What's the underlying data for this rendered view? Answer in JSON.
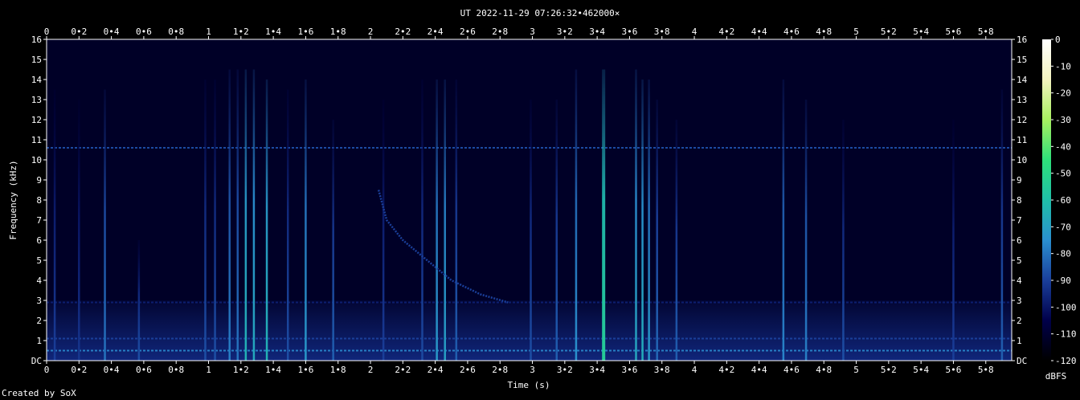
{
  "chart_data": {
    "type": "heatmap",
    "title": "UT 2022-11-29 07:26:32•462000×",
    "xlabel": "Time (s)",
    "ylabel": "Frequency (kHz)",
    "colorbar_label": "dBFS",
    "xlim": [
      0,
      5.96
    ],
    "ylim": [
      0,
      16
    ],
    "x_ticks": [
      "0",
      "0•2",
      "0•4",
      "0•6",
      "0•8",
      "1",
      "1•2",
      "1•4",
      "1•6",
      "1•8",
      "2",
      "2•2",
      "2•4",
      "2•6",
      "2•8",
      "3",
      "3•2",
      "3•4",
      "3•6",
      "3•8",
      "4",
      "4•2",
      "4•4",
      "4•6",
      "4•8",
      "5",
      "5•2",
      "5•4",
      "5•6",
      "5•8"
    ],
    "x_tick_values": [
      0,
      0.2,
      0.4,
      0.6,
      0.8,
      1,
      1.2,
      1.4,
      1.6,
      1.8,
      2,
      2.2,
      2.4,
      2.6,
      2.8,
      3,
      3.2,
      3.4,
      3.6,
      3.8,
      4,
      4.2,
      4.4,
      4.6,
      4.8,
      5,
      5.2,
      5.4,
      5.6,
      5.8
    ],
    "y_ticks": [
      "DC",
      "1",
      "2",
      "3",
      "4",
      "5",
      "6",
      "7",
      "8",
      "9",
      "10",
      "11",
      "12",
      "13",
      "14",
      "15",
      "16"
    ],
    "y_tick_values": [
      0,
      1,
      2,
      3,
      4,
      5,
      6,
      7,
      8,
      9,
      10,
      11,
      12,
      13,
      14,
      15,
      16
    ],
    "colorbar_ticks": [
      "0",
      "-10",
      "-20",
      "-30",
      "-40",
      "-50",
      "-60",
      "-70",
      "-80",
      "-90",
      "-100",
      "-110",
      "-120"
    ],
    "colorbar_values": [
      0,
      -10,
      -20,
      -30,
      -40,
      -50,
      -60,
      -70,
      -80,
      -90,
      -100,
      -110,
      -120
    ],
    "colorbar_range": [
      -120,
      0
    ],
    "colormap": [
      "#000000",
      "#00004a",
      "#1a3f9a",
      "#2a8fd0",
      "#1fbfa8",
      "#2ee07a",
      "#a8f060",
      "#f4f4c0",
      "#ffffff"
    ],
    "background_level_dbfs": -112,
    "low_freq_band": {
      "freq_range_khz": [
        0,
        3
      ],
      "level_dbfs": -96
    },
    "horizontal_lines": [
      {
        "freq_khz": 10.6,
        "level_dbfs": -88
      },
      {
        "freq_khz": 0.5,
        "level_dbfs": -78
      },
      {
        "freq_khz": 1.1,
        "level_dbfs": -90
      },
      {
        "freq_khz": 2.9,
        "level_dbfs": -98
      }
    ],
    "events": [
      {
        "t": 0.05,
        "f_top": 13.5,
        "level_dbfs": -98
      },
      {
        "t": 0.2,
        "f_top": 13.0,
        "level_dbfs": -100
      },
      {
        "t": 0.36,
        "f_top": 13.5,
        "level_dbfs": -88
      },
      {
        "t": 0.57,
        "f_top": 6.0,
        "level_dbfs": -95
      },
      {
        "t": 0.98,
        "f_top": 14.0,
        "level_dbfs": -95
      },
      {
        "t": 1.04,
        "f_top": 14.0,
        "level_dbfs": -95
      },
      {
        "t": 1.13,
        "f_top": 14.5,
        "level_dbfs": -86
      },
      {
        "t": 1.18,
        "f_top": 14.5,
        "level_dbfs": -88
      },
      {
        "t": 1.23,
        "f_top": 14.5,
        "level_dbfs": -72
      },
      {
        "t": 1.28,
        "f_top": 14.5,
        "level_dbfs": -75
      },
      {
        "t": 1.36,
        "f_top": 14.0,
        "level_dbfs": -72
      },
      {
        "t": 1.49,
        "f_top": 13.5,
        "level_dbfs": -95
      },
      {
        "t": 1.6,
        "f_top": 14.0,
        "level_dbfs": -80
      },
      {
        "t": 1.77,
        "f_top": 12.0,
        "level_dbfs": -92
      },
      {
        "t": 2.08,
        "f_top": 13.0,
        "level_dbfs": -98
      },
      {
        "t": 2.32,
        "f_top": 14.0,
        "level_dbfs": -96
      },
      {
        "t": 2.41,
        "f_top": 14.0,
        "level_dbfs": -80
      },
      {
        "t": 2.46,
        "f_top": 14.0,
        "level_dbfs": -78
      },
      {
        "t": 2.53,
        "f_top": 14.0,
        "level_dbfs": -92
      },
      {
        "t": 2.99,
        "f_top": 13.0,
        "level_dbfs": -95
      },
      {
        "t": 3.15,
        "f_top": 13.0,
        "level_dbfs": -92
      },
      {
        "t": 3.27,
        "f_top": 14.5,
        "level_dbfs": -82
      },
      {
        "t": 3.44,
        "f_top": 14.5,
        "level_dbfs": -62
      },
      {
        "t": 3.64,
        "f_top": 14.5,
        "level_dbfs": -76
      },
      {
        "t": 3.68,
        "f_top": 14.0,
        "level_dbfs": -74
      },
      {
        "t": 3.72,
        "f_top": 14.0,
        "level_dbfs": -80
      },
      {
        "t": 3.77,
        "f_top": 13.0,
        "level_dbfs": -90
      },
      {
        "t": 3.89,
        "f_top": 12.0,
        "level_dbfs": -92
      },
      {
        "t": 4.55,
        "f_top": 14.0,
        "level_dbfs": -85
      },
      {
        "t": 4.69,
        "f_top": 13.0,
        "level_dbfs": -86
      },
      {
        "t": 4.92,
        "f_top": 12.0,
        "level_dbfs": -95
      },
      {
        "t": 5.6,
        "f_top": 12.0,
        "level_dbfs": -98
      },
      {
        "t": 5.9,
        "f_top": 13.5,
        "level_dbfs": -92
      }
    ],
    "sweep": {
      "points": [
        [
          2.05,
          8.5
        ],
        [
          2.1,
          7.0
        ],
        [
          2.2,
          6.0
        ],
        [
          2.35,
          5.0
        ],
        [
          2.5,
          4.0
        ],
        [
          2.68,
          3.3
        ],
        [
          2.85,
          2.9
        ]
      ],
      "level_dbfs": -90
    }
  }
}
